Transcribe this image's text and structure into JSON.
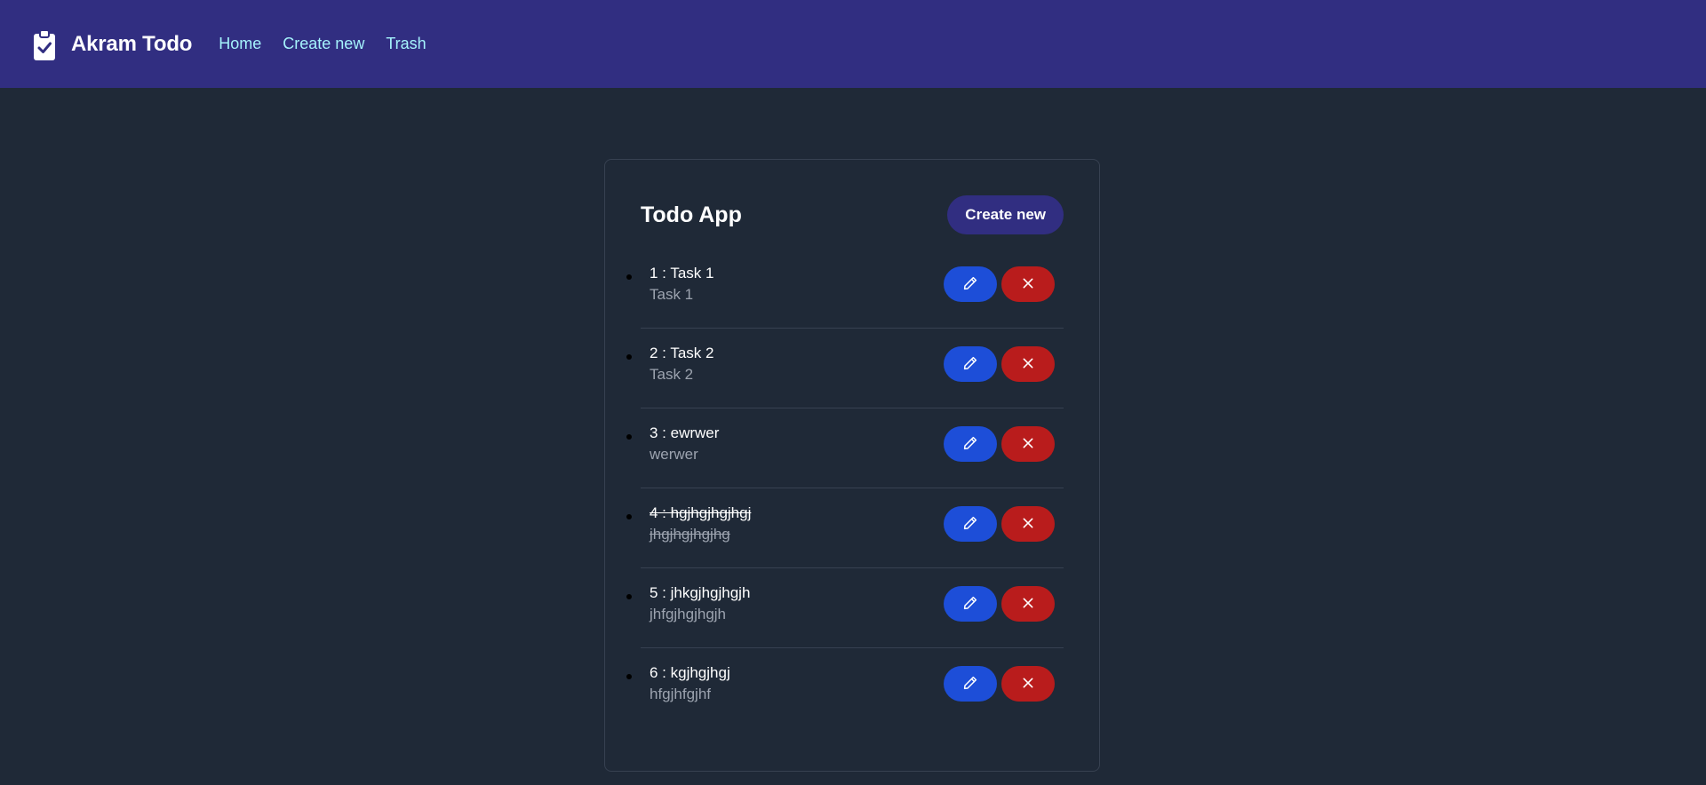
{
  "navbar": {
    "brand_icon": "clipboard-check-icon",
    "brand_title": "Akram Todo",
    "links": [
      "Home",
      "Create new",
      "Trash"
    ],
    "background": "#312e81",
    "link_color": "#a5f3fc"
  },
  "card": {
    "title": "Todo App",
    "create_label": "Create new",
    "todos": [
      {
        "title": "1 : Task 1",
        "desc": "Task 1",
        "done": false
      },
      {
        "title": "2 : Task 2",
        "desc": "Task 2",
        "done": false
      },
      {
        "title": "3 : ewrwer",
        "desc": "werwer",
        "done": false
      },
      {
        "title": "4 : hgjhgjhgjhgj",
        "desc": "jhgjhgjhgjhg",
        "done": true
      },
      {
        "title": "5 : jhkgjhgjhgjh",
        "desc": "jhfgjhgjhgjh",
        "done": false
      },
      {
        "title": "6 : kgjhgjhgj",
        "desc": "hfgjhfgjhf",
        "done": false
      }
    ],
    "edit_icon": "pencil-icon",
    "delete_icon": "close-icon",
    "edit_color": "#1d4ed8",
    "delete_color": "#b91c1c"
  }
}
